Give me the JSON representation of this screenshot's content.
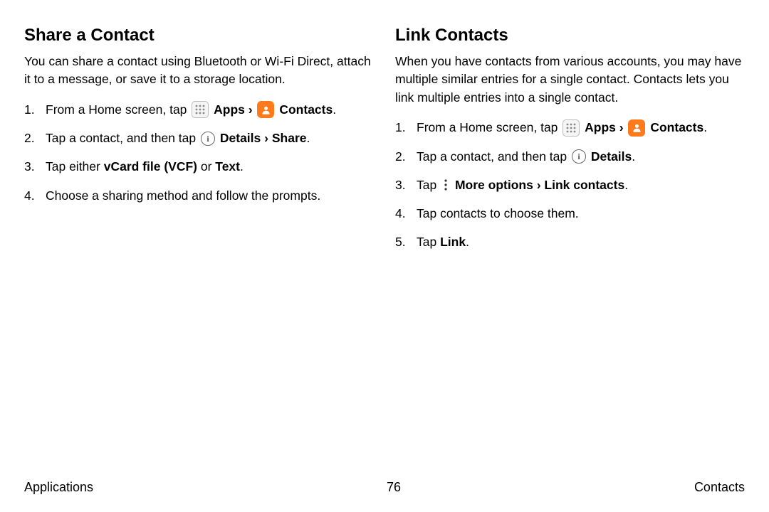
{
  "left": {
    "heading": "Share a Contact",
    "lead": "You can share a contact using Bluetooth or Wi-Fi Direct, attach it to a message, or save it to a storage location.",
    "steps": {
      "s1_a": "From a Home screen, tap ",
      "s1_apps": "Apps",
      "s1_chev": " › ",
      "s1_contacts": "Contacts",
      "s1_end": ".",
      "s2_a": "Tap a contact, and then tap ",
      "s2_details": "Details",
      "s2_chev": " › ",
      "s2_share": "Share",
      "s2_end": ".",
      "s3_a": "Tap either ",
      "s3_vcf": "vCard file (VCF)",
      "s3_or": " or ",
      "s3_text": "Text",
      "s3_end": ".",
      "s4": "Choose a sharing method and follow the prompts."
    }
  },
  "right": {
    "heading": "Link Contacts",
    "lead": "When you have contacts from various accounts, you may have multiple similar entries for a single contact. Contacts lets you link multiple entries into a single contact.",
    "steps": {
      "s1_a": "From a Home screen, tap ",
      "s1_apps": "Apps",
      "s1_chev": " › ",
      "s1_contacts": "Contacts",
      "s1_end": ".",
      "s2_a": "Tap a contact, and then tap ",
      "s2_details": "Details",
      "s2_end": ".",
      "s3_a": "Tap ",
      "s3_more": "More options",
      "s3_chev": " › ",
      "s3_link": "Link contacts",
      "s3_end": ".",
      "s4": "Tap contacts to choose them.",
      "s5_a": "Tap ",
      "s5_link": "Link",
      "s5_end": "."
    }
  },
  "footer": {
    "left": "Applications",
    "center": "76",
    "right": "Contacts"
  },
  "icons": {
    "info_glyph": "i"
  }
}
